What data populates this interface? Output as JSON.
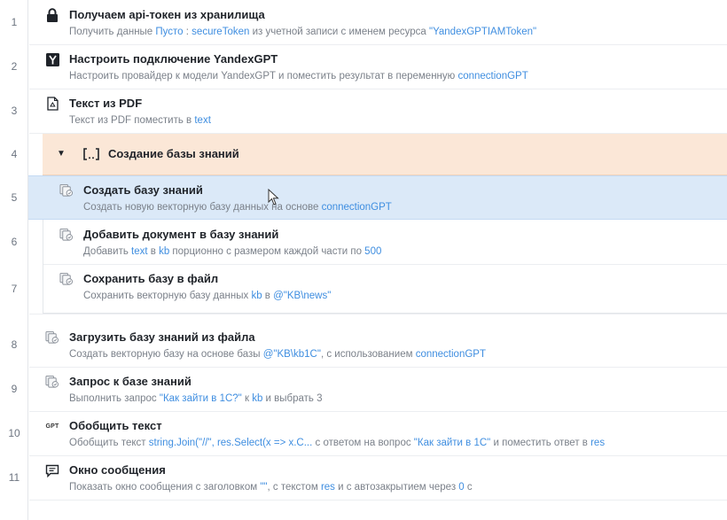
{
  "rows": [
    {
      "num": "1",
      "icon": "lock-icon",
      "title": "Получаем api-токен из хранилища",
      "desc": [
        [
          "Получить данные ",
          ""
        ],
        [
          "Пусто",
          "v"
        ],
        [
          " : ",
          ""
        ],
        [
          "secureToken",
          "v"
        ],
        [
          " из учетной записи с именем ресурса ",
          ""
        ],
        [
          "\"YandexGPTIAMToken\"",
          "v"
        ]
      ]
    },
    {
      "num": "2",
      "icon": "yandex-icon",
      "title": "Настроить подключение YandexGPT",
      "desc": [
        [
          "Настроить провайдер к модели YandexGPT и поместить результат в переменную ",
          ""
        ],
        [
          "connectionGPT",
          "v"
        ]
      ]
    },
    {
      "num": "3",
      "icon": "pdf-file-icon",
      "title": "Текст из PDF",
      "desc": [
        [
          "Текст из PDF поместить в ",
          ""
        ],
        [
          "text",
          "v"
        ]
      ]
    },
    {
      "num": "4",
      "icon": "brackets-icon",
      "title": "Создание базы знаний",
      "desc": []
    },
    {
      "num": "5",
      "icon": "knowledge-base-icon",
      "title": "Создать базу знаний",
      "desc": [
        [
          "Создать новую векторную базу данных на основе ",
          ""
        ],
        [
          "connectionGPT",
          "v"
        ]
      ]
    },
    {
      "num": "6",
      "icon": "knowledge-base-icon",
      "title": "Добавить документ в базу знаний",
      "desc": [
        [
          "Добавить ",
          ""
        ],
        [
          "text",
          "v"
        ],
        [
          " в ",
          ""
        ],
        [
          "kb",
          "v"
        ],
        [
          " порционно с размером каждой части по ",
          ""
        ],
        [
          "500",
          "v"
        ]
      ]
    },
    {
      "num": "7",
      "icon": "knowledge-base-icon",
      "title": "Сохранить базу в файл",
      "desc": [
        [
          "Сохранить векторную базу данных ",
          ""
        ],
        [
          "kb",
          "v"
        ],
        [
          " в ",
          ""
        ],
        [
          "@\"KB\\news\"",
          "v"
        ]
      ]
    },
    {
      "num": "8",
      "icon": "knowledge-base-icon",
      "title": "Загрузить базу знаний из файла",
      "desc": [
        [
          "Создать векторную базу на основе базы ",
          ""
        ],
        [
          "@\"KB\\kb1C\"",
          "v"
        ],
        [
          ", с использованием ",
          ""
        ],
        [
          "connectionGPT",
          "v"
        ]
      ]
    },
    {
      "num": "9",
      "icon": "knowledge-base-icon",
      "title": "Запрос к базе знаний",
      "desc": [
        [
          "Выполнить запрос ",
          ""
        ],
        [
          "\"Как зайти в 1С?\"",
          "v"
        ],
        [
          " к ",
          ""
        ],
        [
          "kb",
          "v"
        ],
        [
          " и выбрать 3",
          ""
        ]
      ]
    },
    {
      "num": "10",
      "icon": "gpt-icon",
      "title": "Обобщить текст",
      "desc": [
        [
          "Обобщить текст ",
          ""
        ],
        [
          "string.Join(\"//\", ",
          "v"
        ],
        [
          "res.Select(x => x.C...",
          "v"
        ],
        [
          " с ответом на вопрос ",
          ""
        ],
        [
          "\"Как зайти в 1С\"",
          "v"
        ],
        [
          " и поместить ответ в ",
          ""
        ],
        [
          "res",
          "v"
        ]
      ]
    },
    {
      "num": "11",
      "icon": "message-box-icon",
      "title": "Окно сообщения",
      "desc": [
        [
          "Показать окно сообщения с заголовком ",
          ""
        ],
        [
          "\"\"",
          "v"
        ],
        [
          ", с текстом ",
          ""
        ],
        [
          "res",
          "v"
        ],
        [
          " и с автозакрытием через ",
          ""
        ],
        [
          "0",
          "v"
        ],
        [
          " с",
          ""
        ]
      ]
    }
  ],
  "gpt_icon_label": "GPT",
  "group_toggle": "▼",
  "group_brackets": "[..]"
}
